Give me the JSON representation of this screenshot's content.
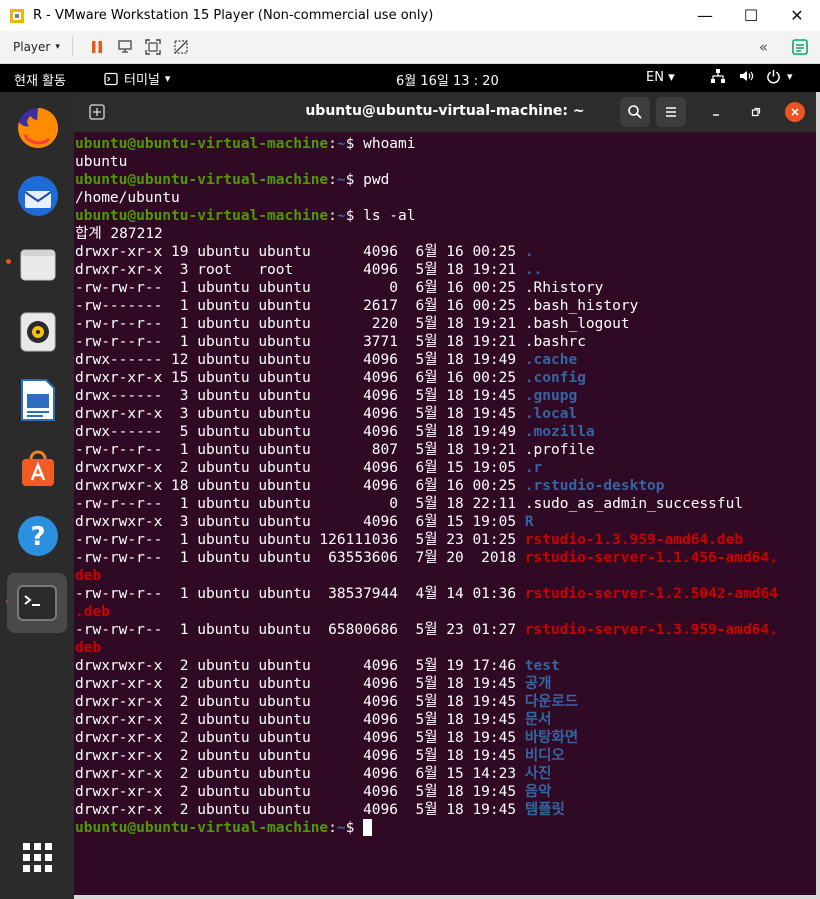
{
  "window": {
    "title": "R - VMware Workstation 15 Player (Non-commercial use only)",
    "controls": {
      "minimize": "—",
      "maximize": "☐",
      "close": "✕"
    }
  },
  "vm_toolbar": {
    "player_label": "Player",
    "caret": "▾",
    "collapse": "«"
  },
  "gnome_bar": {
    "activities": "현재 활동",
    "app_menu": "터미널",
    "clock": "6월 16일  13 : 20",
    "lang": "EN ▾",
    "caret": "▾"
  },
  "dock": {
    "apps": [
      "firefox",
      "thunderbird",
      "files",
      "rhythmbox",
      "libreoffice-writer",
      "software",
      "help",
      "terminal"
    ]
  },
  "terminal": {
    "title": "ubuntu@ubuntu-virtual-machine: ~",
    "prompt_user": "ubuntu@ubuntu-virtual-machine",
    "prompt_path": "~",
    "lines": [
      {
        "kind": "prompt",
        "cmd": "whoami"
      },
      {
        "kind": "text",
        "text": "ubuntu"
      },
      {
        "kind": "prompt",
        "cmd": "pwd"
      },
      {
        "kind": "text",
        "text": "/home/ubuntu"
      },
      {
        "kind": "prompt",
        "cmd": "ls -al"
      },
      {
        "kind": "text",
        "text": "합계 287212"
      },
      {
        "kind": "entry",
        "meta": "drwxr-xr-x 19 ubuntu ubuntu      4096  6월 16 00:25 ",
        "name": ".",
        "type": "dir"
      },
      {
        "kind": "entry",
        "meta": "drwxr-xr-x  3 root   root        4096  5월 18 19:21 ",
        "name": "..",
        "type": "dir"
      },
      {
        "kind": "entry",
        "meta": "-rw-rw-r--  1 ubuntu ubuntu         0  6월 16 00:25 ",
        "name": ".Rhistory",
        "type": "file"
      },
      {
        "kind": "entry",
        "meta": "-rw-------  1 ubuntu ubuntu      2617  6월 16 00:25 ",
        "name": ".bash_history",
        "type": "file"
      },
      {
        "kind": "entry",
        "meta": "-rw-r--r--  1 ubuntu ubuntu       220  5월 18 19:21 ",
        "name": ".bash_logout",
        "type": "file"
      },
      {
        "kind": "entry",
        "meta": "-rw-r--r--  1 ubuntu ubuntu      3771  5월 18 19:21 ",
        "name": ".bashrc",
        "type": "file"
      },
      {
        "kind": "entry",
        "meta": "drwx------ 12 ubuntu ubuntu      4096  5월 18 19:49 ",
        "name": ".cache",
        "type": "dir"
      },
      {
        "kind": "entry",
        "meta": "drwxr-xr-x 15 ubuntu ubuntu      4096  6월 16 00:25 ",
        "name": ".config",
        "type": "dir"
      },
      {
        "kind": "entry",
        "meta": "drwx------  3 ubuntu ubuntu      4096  5월 18 19:45 ",
        "name": ".gnupg",
        "type": "dir"
      },
      {
        "kind": "entry",
        "meta": "drwxr-xr-x  3 ubuntu ubuntu      4096  5월 18 19:45 ",
        "name": ".local",
        "type": "dir"
      },
      {
        "kind": "entry",
        "meta": "drwx------  5 ubuntu ubuntu      4096  5월 18 19:49 ",
        "name": ".mozilla",
        "type": "dir"
      },
      {
        "kind": "entry",
        "meta": "-rw-r--r--  1 ubuntu ubuntu       807  5월 18 19:21 ",
        "name": ".profile",
        "type": "file"
      },
      {
        "kind": "entry",
        "meta": "drwxrwxr-x  2 ubuntu ubuntu      4096  6월 15 19:05 ",
        "name": ".r",
        "type": "dir"
      },
      {
        "kind": "entry",
        "meta": "drwxrwxr-x 18 ubuntu ubuntu      4096  6월 16 00:25 ",
        "name": ".rstudio-desktop",
        "type": "dir"
      },
      {
        "kind": "entry",
        "meta": "-rw-r--r--  1 ubuntu ubuntu         0  5월 18 22:11 ",
        "name": ".sudo_as_admin_successful",
        "type": "file"
      },
      {
        "kind": "entry",
        "meta": "drwxrwxr-x  3 ubuntu ubuntu      4096  6월 15 19:05 ",
        "name": "R",
        "type": "dir"
      },
      {
        "kind": "entry",
        "meta": "-rw-rw-r--  1 ubuntu ubuntu 126111036  5월 23 01:25 ",
        "name": "rstudio-1.3.959-amd64.deb",
        "type": "deb"
      },
      {
        "kind": "entry",
        "meta": "-rw-rw-r--  1 ubuntu ubuntu  63553606  7월 20  2018 ",
        "name": "rstudio-server-1.1.456-amd64.",
        "type": "deb"
      },
      {
        "kind": "cont",
        "name": "deb",
        "type": "deb"
      },
      {
        "kind": "entry",
        "meta": "-rw-rw-r--  1 ubuntu ubuntu  38537944  4월 14 01:36 ",
        "name": "rstudio-server-1.2.5042-amd64",
        "type": "deb"
      },
      {
        "kind": "cont",
        "name": ".deb",
        "type": "deb"
      },
      {
        "kind": "entry",
        "meta": "-rw-rw-r--  1 ubuntu ubuntu  65800686  5월 23 01:27 ",
        "name": "rstudio-server-1.3.959-amd64.",
        "type": "deb"
      },
      {
        "kind": "cont",
        "name": "deb",
        "type": "deb"
      },
      {
        "kind": "entry",
        "meta": "drwxrwxr-x  2 ubuntu ubuntu      4096  5월 19 17:46 ",
        "name": "test",
        "type": "dir"
      },
      {
        "kind": "entry",
        "meta": "drwxr-xr-x  2 ubuntu ubuntu      4096  5월 18 19:45 ",
        "name": "공개",
        "type": "dir"
      },
      {
        "kind": "entry",
        "meta": "drwxr-xr-x  2 ubuntu ubuntu      4096  5월 18 19:45 ",
        "name": "다운로드",
        "type": "dir"
      },
      {
        "kind": "entry",
        "meta": "drwxr-xr-x  2 ubuntu ubuntu      4096  5월 18 19:45 ",
        "name": "문서",
        "type": "dir"
      },
      {
        "kind": "entry",
        "meta": "drwxr-xr-x  2 ubuntu ubuntu      4096  5월 18 19:45 ",
        "name": "바탕화면",
        "type": "dir"
      },
      {
        "kind": "entry",
        "meta": "drwxr-xr-x  2 ubuntu ubuntu      4096  5월 18 19:45 ",
        "name": "비디오",
        "type": "dir"
      },
      {
        "kind": "entry",
        "meta": "drwxr-xr-x  2 ubuntu ubuntu      4096  6월 15 14:23 ",
        "name": "사진",
        "type": "dir"
      },
      {
        "kind": "entry",
        "meta": "drwxr-xr-x  2 ubuntu ubuntu      4096  5월 18 19:45 ",
        "name": "음악",
        "type": "dir"
      },
      {
        "kind": "entry",
        "meta": "drwxr-xr-x  2 ubuntu ubuntu      4096  5월 18 19:45 ",
        "name": "템플릿",
        "type": "dir"
      },
      {
        "kind": "prompt",
        "cmd": "",
        "cursor": true
      }
    ]
  },
  "colors": {
    "terminal_bg": "#300a24",
    "prompt_user": "#4e9a06",
    "directory": "#3465a4",
    "deb_archive": "#cc0000",
    "dock_bg": "#2b2b2b",
    "ubuntu_orange": "#e95420"
  }
}
